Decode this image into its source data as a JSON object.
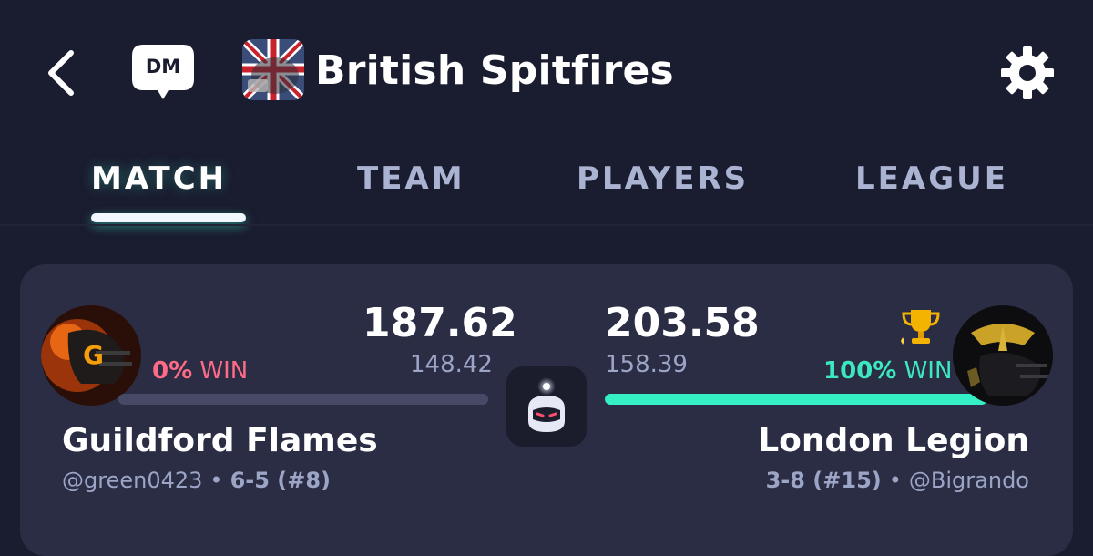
{
  "header": {
    "league_name": "British Spitfires",
    "dm_label": "DM",
    "back_icon": "chevron-left-icon",
    "settings_icon": "gear-icon"
  },
  "tabs": [
    {
      "label": "MATCH",
      "active": true
    },
    {
      "label": "TEAM",
      "active": false
    },
    {
      "label": "PLAYERS",
      "active": false
    },
    {
      "label": "LEAGUE",
      "active": false
    }
  ],
  "matchup": {
    "left": {
      "team_name": "Guildford Flames",
      "owner": "@green0423",
      "record": "6-5 (#8)",
      "score": "187.62",
      "projected": "148.42",
      "win_pct": "0%",
      "win_label": "WIN",
      "win_fraction": 0
    },
    "right": {
      "team_name": "London Legion",
      "owner": "@Bigrando",
      "record": "3-8 (#15)",
      "score": "203.58",
      "projected": "158.39",
      "win_pct": "100%",
      "win_label": "WIN",
      "win_fraction": 1.0,
      "winner": true
    },
    "separator": "•"
  },
  "colors": {
    "background": "#1a1c2f",
    "card": "#2a2d44",
    "accent_teal": "#35f0c4",
    "loss_pink": "#ff6b86",
    "muted": "#9ca5c6"
  }
}
